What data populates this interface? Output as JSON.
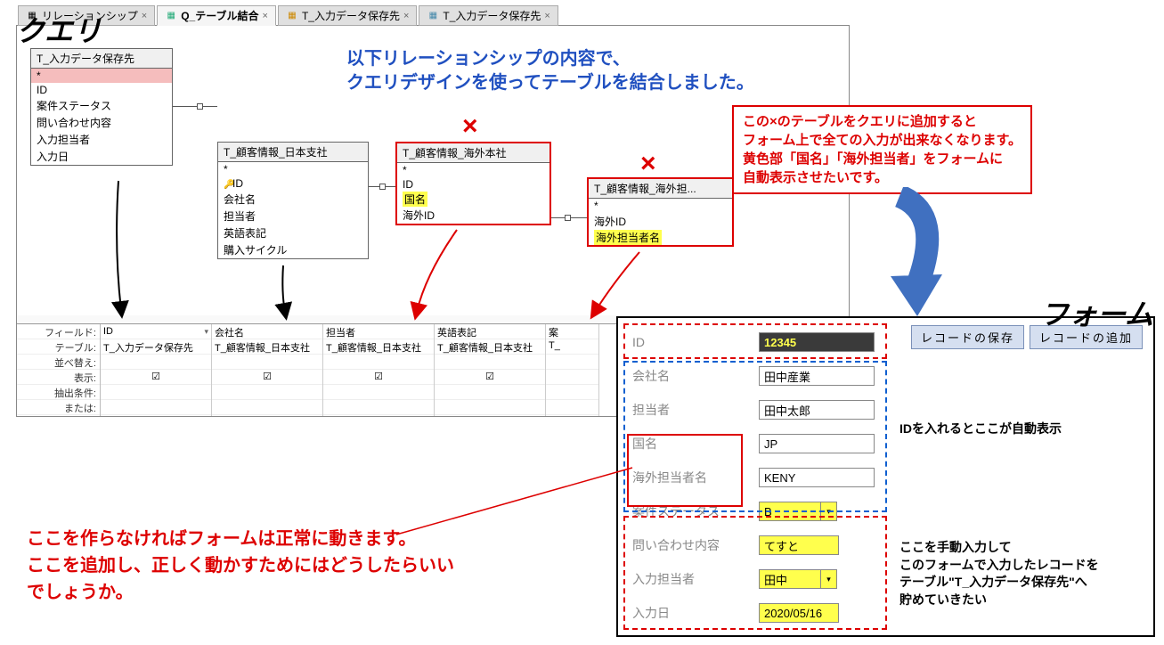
{
  "labels": {
    "query": "クエリ",
    "form": "フォーム"
  },
  "tabs": [
    {
      "label": "リレーションシップ",
      "icon_color": "#d88",
      "active": false
    },
    {
      "label": "Q_テーブル結合",
      "icon_color": "#9b9",
      "active": true
    },
    {
      "label": "T_入力データ保存先",
      "icon_color": "#ca8",
      "active": false
    },
    {
      "label": "T_入力データ保存先",
      "icon_color": "#7ab",
      "active": false
    }
  ],
  "blue_note": {
    "line1": "以下リレーションシップの内容で、",
    "line2": "クエリデザインを使ってテーブルを結合しました。"
  },
  "red_note": {
    "line1": "この×のテーブルをクエリに追加すると",
    "line2": "フォーム上で全ての入力が出来なくなります。",
    "line3": "黄色部「国名」「海外担当者」をフォームに",
    "line4": "自動表示させたいです。"
  },
  "tables": {
    "t1": {
      "title": "T_入力データ保存先",
      "rows": [
        "*",
        "ID",
        "案件ステータス",
        "問い合わせ内容",
        "入力担当者",
        "入力日"
      ]
    },
    "t2": {
      "title": "T_顧客情報_日本支社",
      "rows": [
        "*",
        "ID",
        "会社名",
        "担当者",
        "英語表記",
        "購入サイクル"
      ],
      "key_row": 1
    },
    "t3": {
      "title": "T_顧客情報_海外本社",
      "rows": [
        "*",
        "ID",
        "国名",
        "海外ID"
      ],
      "highlight_row": 2
    },
    "t4": {
      "title": "T_顧客情報_海外担...",
      "rows": [
        "*",
        "海外ID",
        "海外担当者名"
      ],
      "highlight_row": 2
    }
  },
  "x_marks": [
    "×",
    "×"
  ],
  "qbe": {
    "labels": [
      "フィールド:",
      "テーブル:",
      "並べ替え:",
      "表示:",
      "抽出条件:",
      "または:"
    ],
    "cols": [
      {
        "field": "ID",
        "table": "T_入力データ保存先",
        "show": true,
        "dropdown": true
      },
      {
        "field": "会社名",
        "table": "T_顧客情報_日本支社",
        "show": true
      },
      {
        "field": "担当者",
        "table": "T_顧客情報_日本支社",
        "show": true
      },
      {
        "field": "英語表記",
        "table": "T_顧客情報_日本支社",
        "show": true
      },
      {
        "field": "案",
        "table": "T_",
        "show": true
      }
    ]
  },
  "form": {
    "buttons": {
      "save": "レコードの保存",
      "add": "レコードの追加"
    },
    "rows": [
      {
        "label": "ID",
        "value": "12345",
        "style": "dark"
      },
      {
        "label": "会社名",
        "value": "田中産業",
        "style": "plain"
      },
      {
        "label": "担当者",
        "value": "田中太郎",
        "style": "plain"
      },
      {
        "label": "国名",
        "value": "JP",
        "style": "plain"
      },
      {
        "label": "海外担当者名",
        "value": "KENY",
        "style": "plain"
      },
      {
        "label": "案件ステータス",
        "value": "B",
        "style": "hl-select"
      },
      {
        "label": "問い合わせ内容",
        "value": "てすと",
        "style": "hl"
      },
      {
        "label": "入力担当者",
        "value": "田中",
        "style": "hl-select"
      },
      {
        "label": "入力日",
        "value": "2020/05/16",
        "style": "hl"
      }
    ],
    "ann_auto": "IDを入れるとここが自動表示",
    "ann_manual": {
      "line1": "ここを手動入力して",
      "line2": "このフォームで入力したレコードを",
      "line3": "テーブル\"T_入力データ保存先\"へ",
      "line4": "貯めていきたい"
    }
  },
  "red_question": {
    "line1": "ここを作らなければフォームは正常に動きます。",
    "line2": "ここを追加し、正しく動かすためにはどうしたらいい",
    "line3": "でしょうか。"
  }
}
